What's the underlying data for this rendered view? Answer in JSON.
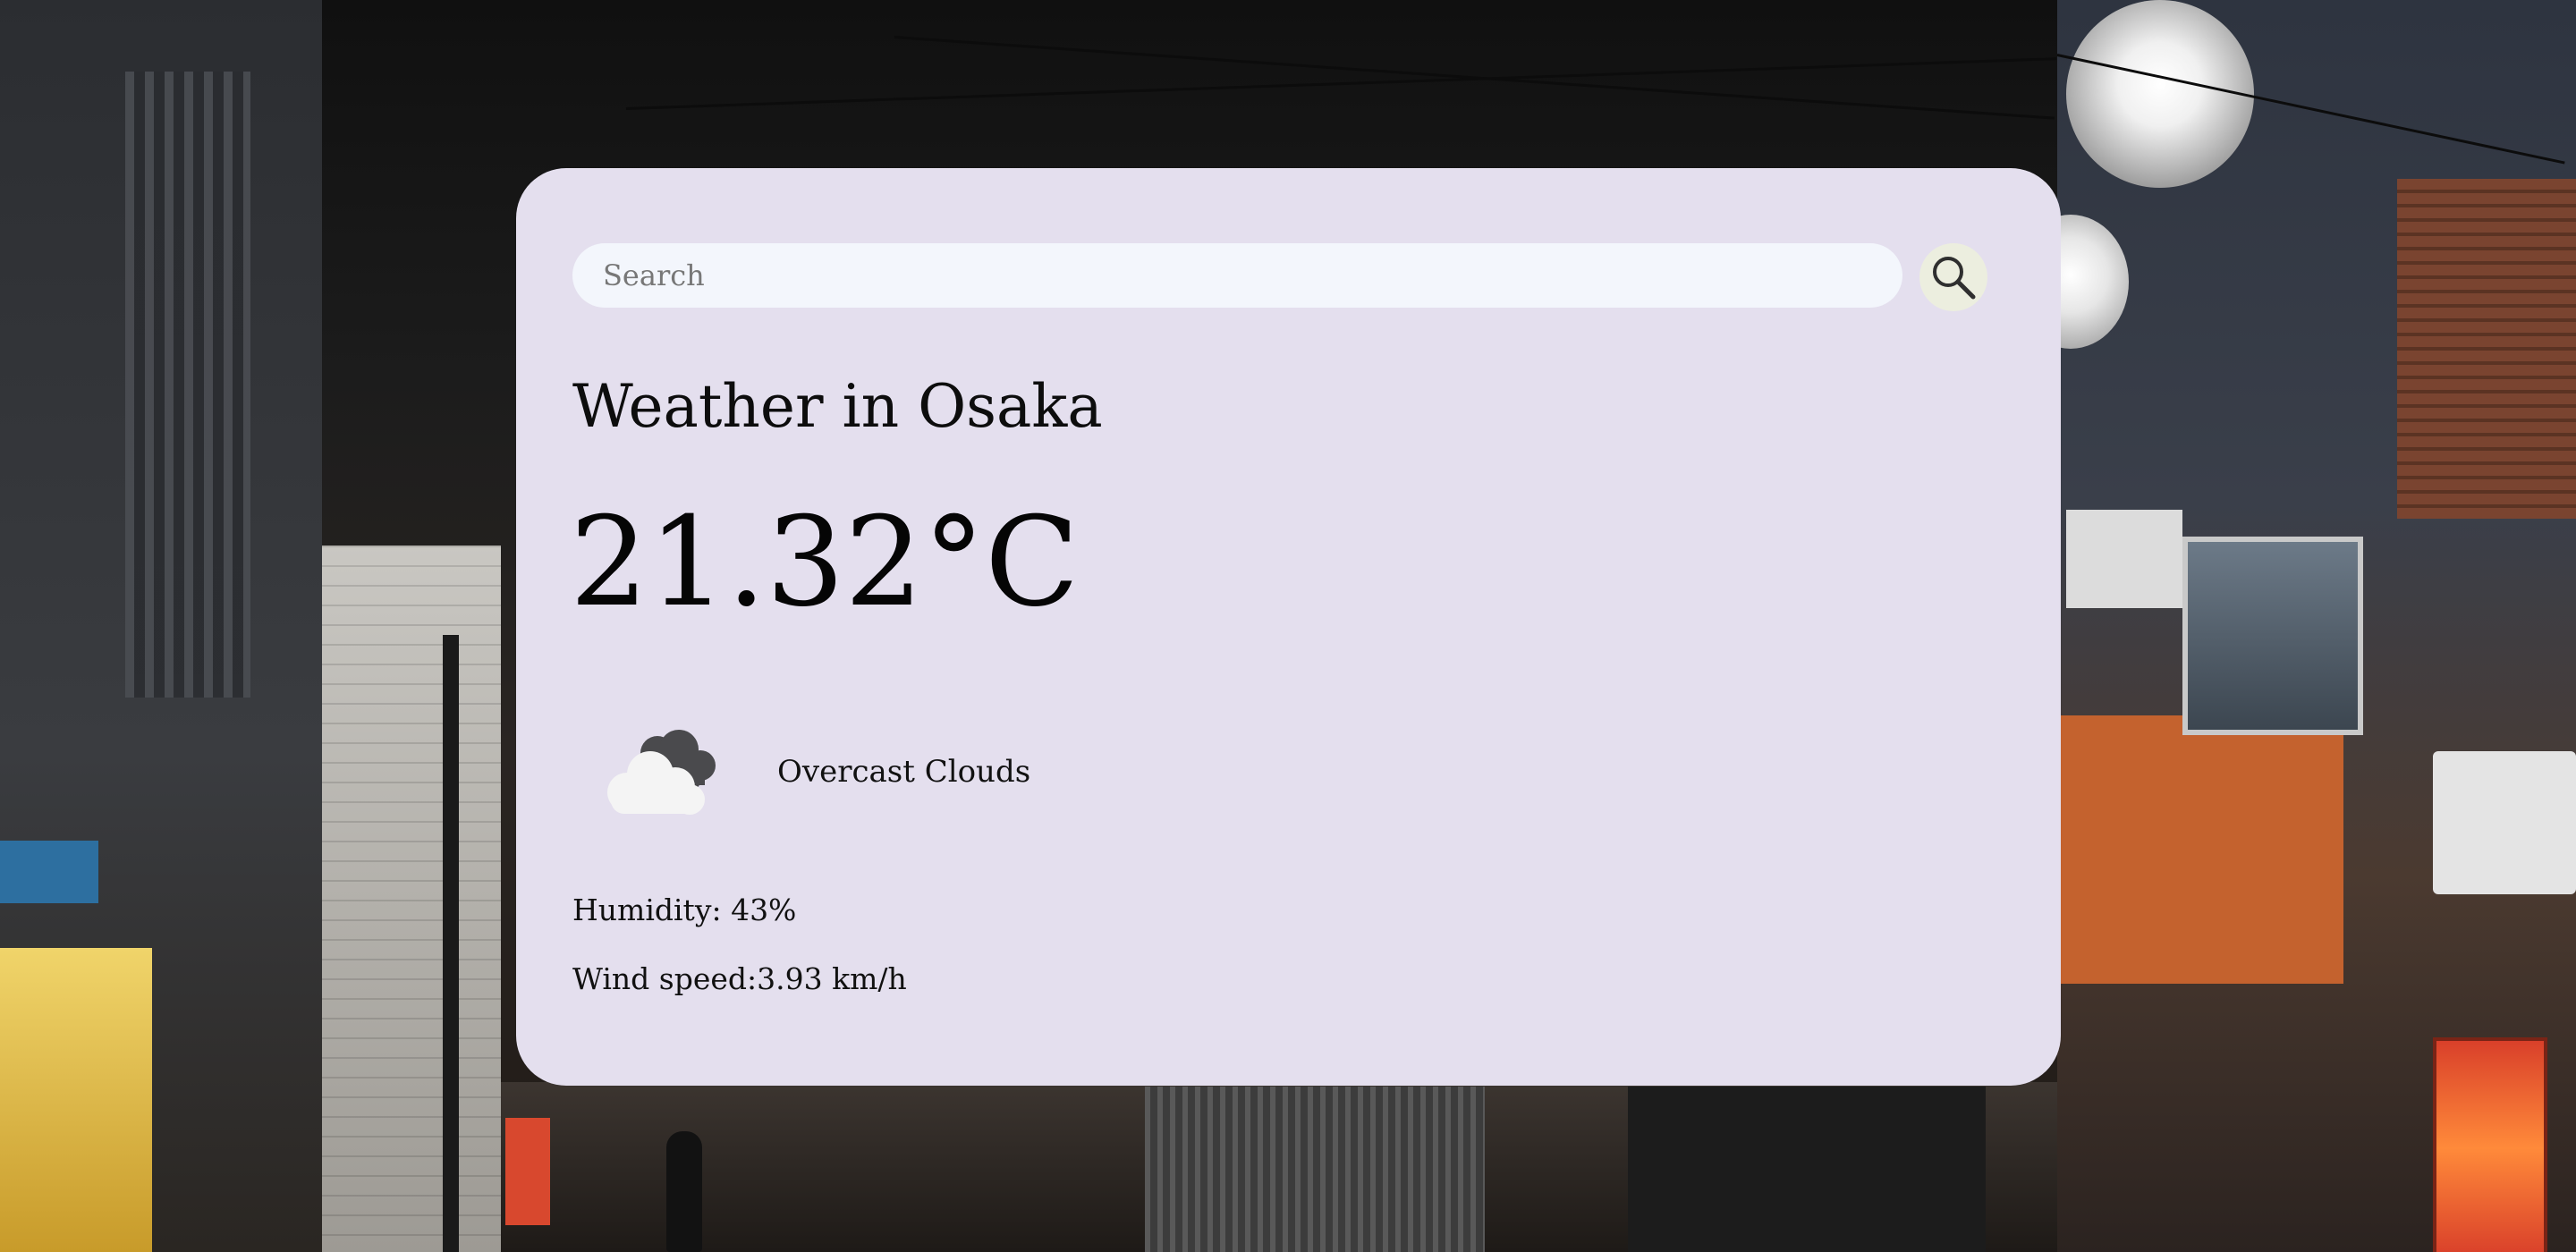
{
  "search": {
    "placeholder": "Search",
    "value": "",
    "button_icon": "search-icon"
  },
  "weather": {
    "title": "Weather in Osaka",
    "temperature": "21.32°C",
    "condition_icon": "overcast-clouds-icon",
    "condition": "Overcast Clouds",
    "humidity": "Humidity: 43%",
    "wind": "Wind speed:3.93 km/h"
  },
  "colors": {
    "card_background": "#e4dfee",
    "search_background": "#f3f6fc",
    "search_button_background": "#eceedf",
    "text": "#0d0d0d"
  }
}
